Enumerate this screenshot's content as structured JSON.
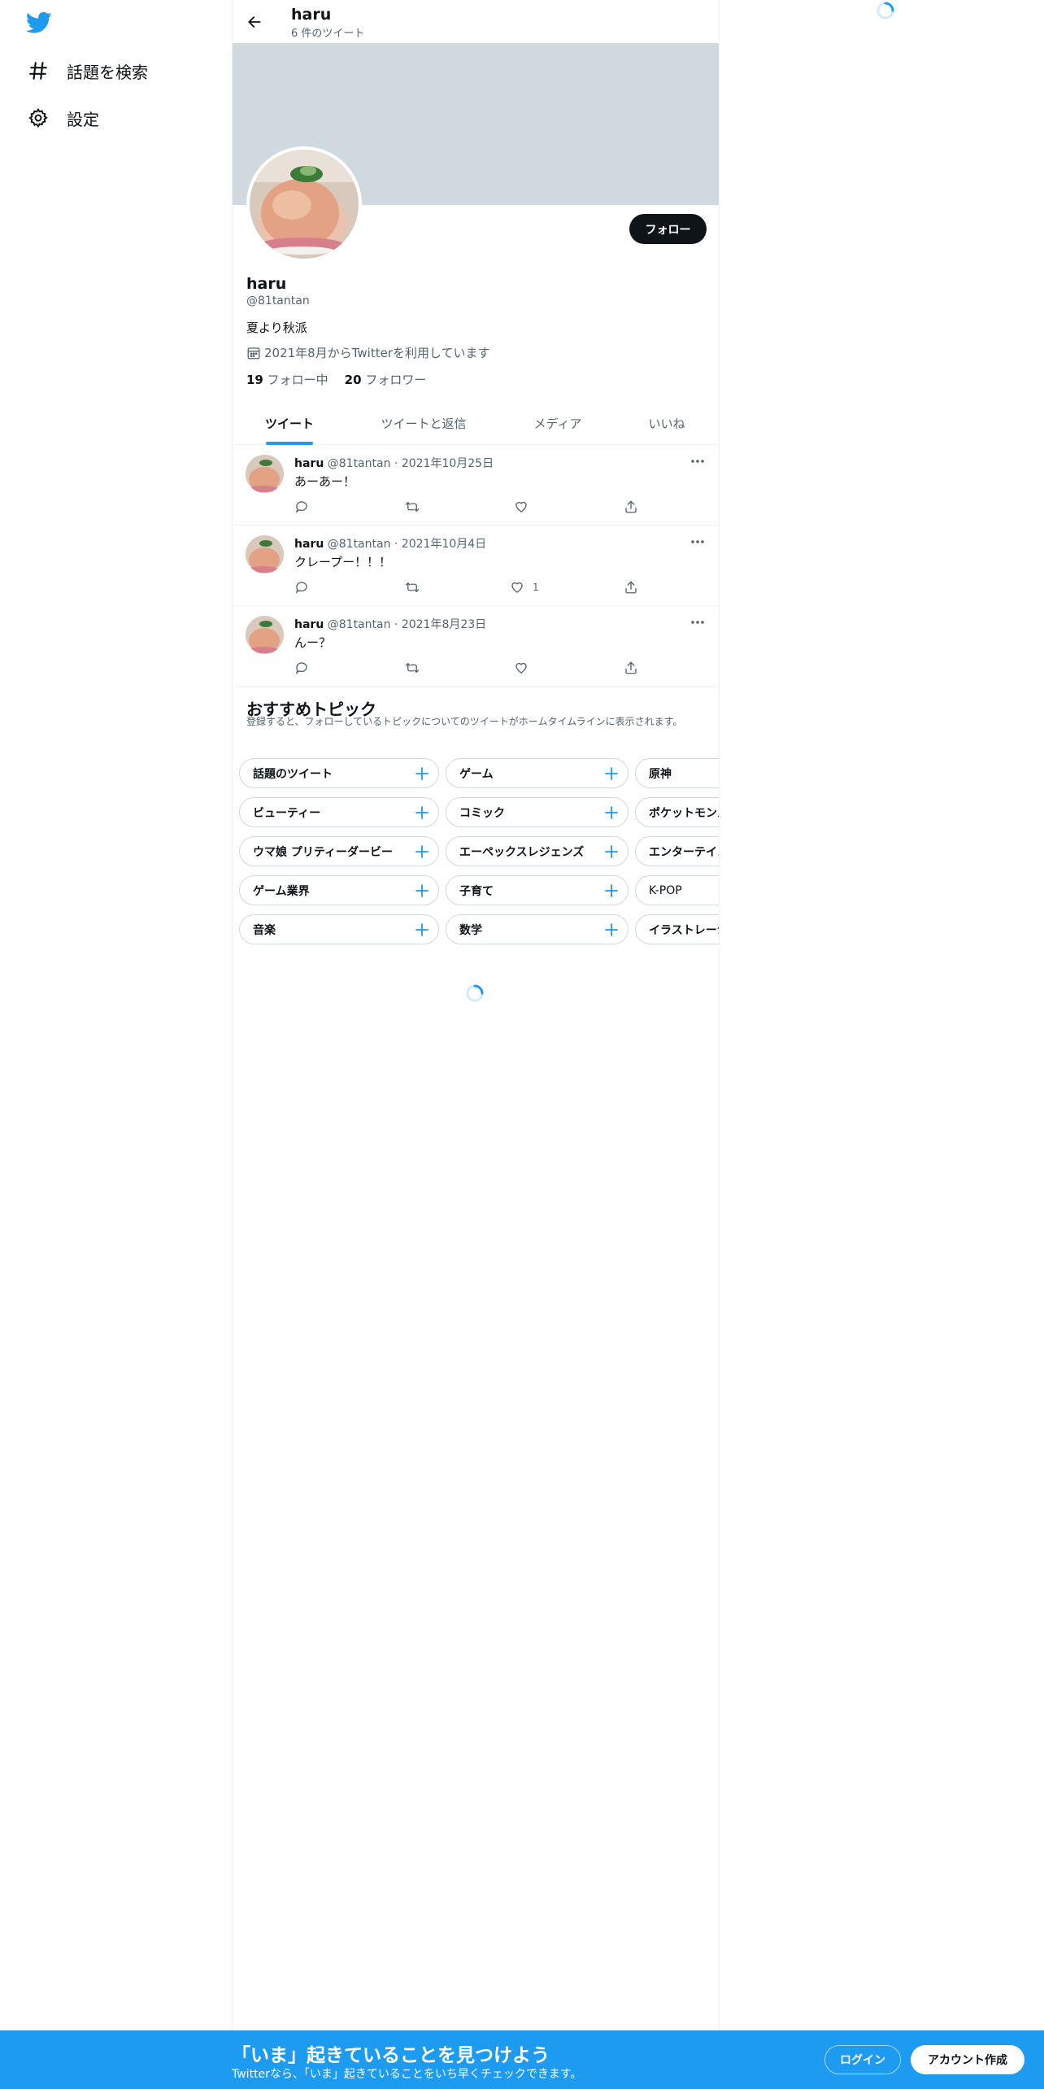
{
  "nav": {
    "logo_icon": "twitter-bird-icon",
    "items": [
      {
        "label": "話題を検索",
        "icon": "hashtag-icon"
      },
      {
        "label": "設定",
        "icon": "gear-icon"
      }
    ]
  },
  "header": {
    "name": "haru",
    "tweet_count": "6 件のツイート"
  },
  "profile": {
    "follow_label": "フォロー",
    "name": "haru",
    "handle": "@81tantan",
    "bio": "夏より秋派",
    "joined": "2021年8月からTwitterを利用しています",
    "following_count": "19",
    "following_label": "フォロー中",
    "followers_count": "20",
    "followers_label": "フォロワー"
  },
  "tabs": [
    "ツイート",
    "ツイートと返信",
    "メディア",
    "いいね"
  ],
  "tweets": [
    {
      "name": "haru",
      "handle": "@81tantan",
      "sep": "·",
      "date": "2021年10月25日",
      "text": "あーあー！",
      "likes": ""
    },
    {
      "name": "haru",
      "handle": "@81tantan",
      "sep": "·",
      "date": "2021年10月4日",
      "text": "クレープー！！！",
      "likes": "1"
    },
    {
      "name": "haru",
      "handle": "@81tantan",
      "sep": "·",
      "date": "2021年8月23日",
      "text": "んー？",
      "likes": ""
    }
  ],
  "topics": {
    "title": "おすすめトピック",
    "description": "登録すると、フォローしているトピックについてのツイートがホームタイムラインに表示されます。",
    "rows": [
      [
        "話題のツイート",
        "ゲーム",
        "原神"
      ],
      [
        "ビューティー",
        "コミック",
        "ポケットモンスター"
      ],
      [
        "ウマ娘 プリティーダービー",
        "エーペックスレジェンズ",
        "エンターテイメント"
      ],
      [
        "ゲーム業界",
        "子育て",
        "K-POP"
      ],
      [
        "音楽",
        "数学",
        "イラストレーション"
      ]
    ]
  },
  "bottom_bar": {
    "title": "「いま」起きていることを見つけよう",
    "subtitle": "Twitterなら、「いま」起きていることをいち早くチェックできます。",
    "login_label": "ログイン",
    "signup_label": "アカウント作成"
  },
  "colors": {
    "accent": "#1d9bf0",
    "banner": "#cfd9de",
    "text_primary": "#0f1419",
    "text_secondary": "#536471"
  }
}
